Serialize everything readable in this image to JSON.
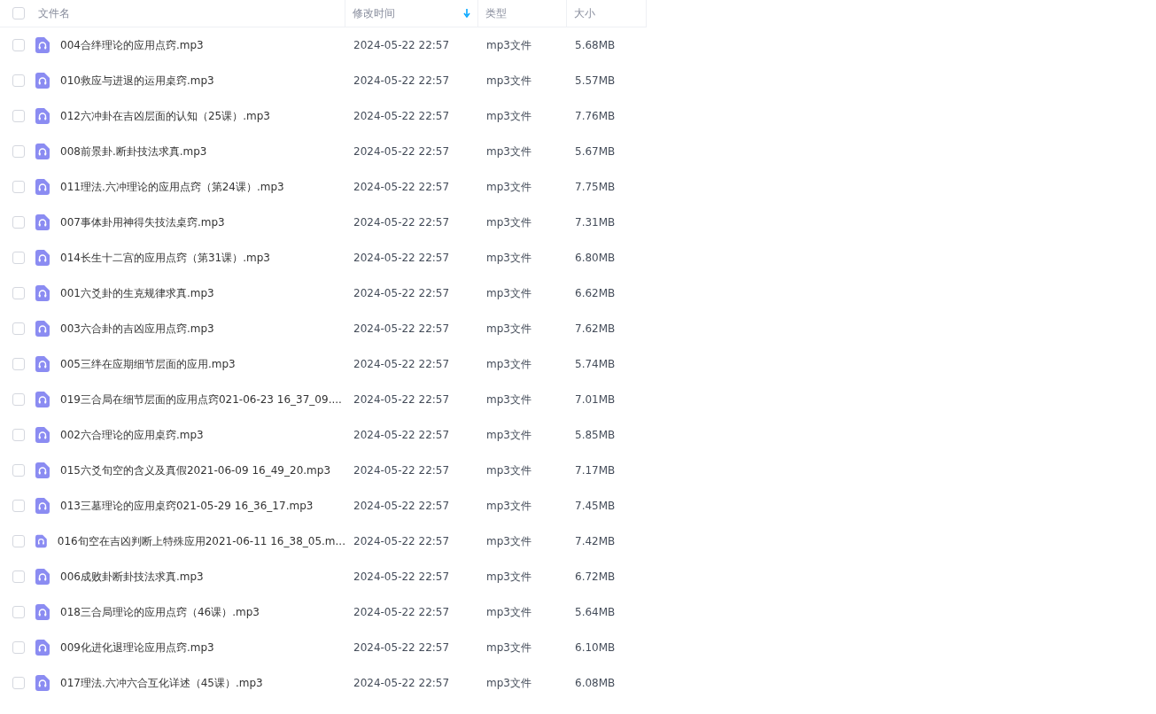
{
  "header": {
    "select_all": {
      "checked": false
    },
    "columns": [
      {
        "label": "文件名",
        "sorted": false
      },
      {
        "label": "修改时间",
        "sorted": true
      },
      {
        "label": "类型",
        "sorted": false
      },
      {
        "label": "大小",
        "sorted": false
      }
    ]
  },
  "rows": [
    {
      "name": "004合绊理论的应用点窍.mp3",
      "modified": "2024-05-22 22:57",
      "type": "mp3文件",
      "size": "5.68MB",
      "checked": false
    },
    {
      "name": "010救应与进退的运用桌窍.mp3",
      "modified": "2024-05-22 22:57",
      "type": "mp3文件",
      "size": "5.57MB",
      "checked": false
    },
    {
      "name": "012六冲卦在吉凶层面的认知（25课）.mp3",
      "modified": "2024-05-22 22:57",
      "type": "mp3文件",
      "size": "7.76MB",
      "checked": false
    },
    {
      "name": "008前景卦.断卦技法求真.mp3",
      "modified": "2024-05-22 22:57",
      "type": "mp3文件",
      "size": "5.67MB",
      "checked": false
    },
    {
      "name": "011理法.六冲理论的应用点窍（第24课）.mp3",
      "modified": "2024-05-22 22:57",
      "type": "mp3文件",
      "size": "7.75MB",
      "checked": false
    },
    {
      "name": "007事体卦用神得失技法桌窍.mp3",
      "modified": "2024-05-22 22:57",
      "type": "mp3文件",
      "size": "7.31MB",
      "checked": false
    },
    {
      "name": "014长生十二宫的应用点窍（第31课）.mp3",
      "modified": "2024-05-22 22:57",
      "type": "mp3文件",
      "size": "6.80MB",
      "checked": false
    },
    {
      "name": "001六爻卦的生克规律求真.mp3",
      "modified": "2024-05-22 22:57",
      "type": "mp3文件",
      "size": "6.62MB",
      "checked": false
    },
    {
      "name": "003六合卦的吉凶应用点窍.mp3",
      "modified": "2024-05-22 22:57",
      "type": "mp3文件",
      "size": "7.62MB",
      "checked": false
    },
    {
      "name": "005三绊在应期细节层面的应用.mp3",
      "modified": "2024-05-22 22:57",
      "type": "mp3文件",
      "size": "5.74MB",
      "checked": false
    },
    {
      "name": "019三合局在细节层面的应用点窍021-06-23 16_37_09....",
      "modified": "2024-05-22 22:57",
      "type": "mp3文件",
      "size": "7.01MB",
      "checked": false
    },
    {
      "name": "002六合理论的应用桌窍.mp3",
      "modified": "2024-05-22 22:57",
      "type": "mp3文件",
      "size": "5.85MB",
      "checked": false
    },
    {
      "name": "015六爻旬空的含义及真假2021-06-09 16_49_20.mp3",
      "modified": "2024-05-22 22:57",
      "type": "mp3文件",
      "size": "7.17MB",
      "checked": false
    },
    {
      "name": "013三墓理论的应用桌窍021-05-29 16_36_17.mp3",
      "modified": "2024-05-22 22:57",
      "type": "mp3文件",
      "size": "7.45MB",
      "checked": false
    },
    {
      "name": "016旬空在吉凶判断上特殊应用2021-06-11 16_38_05.m...",
      "modified": "2024-05-22 22:57",
      "type": "mp3文件",
      "size": "7.42MB",
      "checked": false
    },
    {
      "name": "006成败卦断卦技法求真.mp3",
      "modified": "2024-05-22 22:57",
      "type": "mp3文件",
      "size": "6.72MB",
      "checked": false
    },
    {
      "name": "018三合局理论的应用点窍（46课）.mp3",
      "modified": "2024-05-22 22:57",
      "type": "mp3文件",
      "size": "5.64MB",
      "checked": false
    },
    {
      "name": "009化进化退理论应用点窍.mp3",
      "modified": "2024-05-22 22:57",
      "type": "mp3文件",
      "size": "6.10MB",
      "checked": false
    },
    {
      "name": "017理法.六冲六合互化详述（45课）.mp3",
      "modified": "2024-05-22 22:57",
      "type": "mp3文件",
      "size": "6.08MB",
      "checked": false
    }
  ]
}
